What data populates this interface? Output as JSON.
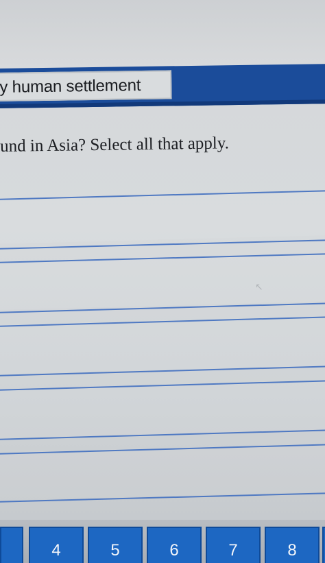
{
  "header": {
    "title": "ly human settlement"
  },
  "question": {
    "text": "und in Asia? Select all that apply."
  },
  "options": [
    {
      "label": ""
    },
    {
      "label": ""
    },
    {
      "label": ""
    },
    {
      "label": ""
    },
    {
      "label": ""
    }
  ],
  "pagination": {
    "pages": [
      "4",
      "5",
      "6",
      "7",
      "8"
    ]
  },
  "colors": {
    "header_blue": "#1b4c9a",
    "option_line": "#4f79c2",
    "page_button": "#1d67c2"
  }
}
